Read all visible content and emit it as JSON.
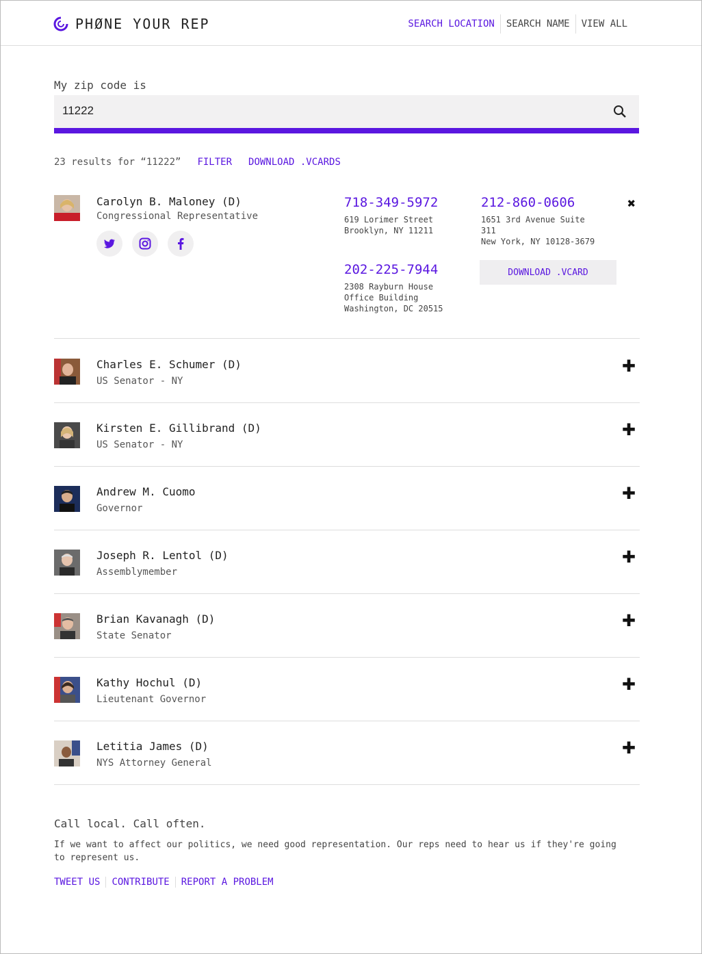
{
  "header": {
    "logo_text": "PHØNE YOUR REP",
    "nav": [
      {
        "label": "SEARCH LOCATION"
      },
      {
        "label": "SEARCH NAME"
      },
      {
        "label": "VIEW ALL"
      }
    ]
  },
  "search": {
    "label": "My zip code is",
    "value": "11222"
  },
  "results": {
    "summary": "23 results for “11222”",
    "filter_label": "FILTER",
    "download_label": "DOWNLOAD .VCARDS"
  },
  "expanded_rep": {
    "name": "Carolyn B. Maloney (D)",
    "title": "Congressional Representative",
    "offices": [
      {
        "phone": "718-349-5972",
        "address_1": "619 Lorimer Street",
        "address_2": "Brooklyn, NY 11211",
        "address_3": ""
      },
      {
        "phone": "212-860-0606",
        "address_1": "1651 3rd Avenue Suite",
        "address_2": "311",
        "address_3": "New York, NY 10128-3679"
      },
      {
        "phone": "202-225-7944",
        "address_1": "2308 Rayburn House",
        "address_2": "Office Building",
        "address_3": "Washington, DC 20515"
      }
    ],
    "vcard_label": "DOWNLOAD .VCARD",
    "social": [
      "twitter-icon",
      "instagram-icon",
      "facebook-icon"
    ]
  },
  "reps": [
    {
      "name": "Charles E. Schumer (D)",
      "title": "US Senator - NY"
    },
    {
      "name": "Kirsten E. Gillibrand (D)",
      "title": "US Senator - NY"
    },
    {
      "name": "Andrew M. Cuomo",
      "title": "Governor"
    },
    {
      "name": "Joseph R. Lentol (D)",
      "title": "Assemblymember"
    },
    {
      "name": "Brian Kavanagh (D)",
      "title": "State Senator"
    },
    {
      "name": "Kathy Hochul (D)",
      "title": "Lieutenant Governor"
    },
    {
      "name": "Letitia James (D)",
      "title": "NYS Attorney General"
    }
  ],
  "footer": {
    "tagline": "Call local. Call often.",
    "mission": "If we want to affect our politics, we need good representation. Our reps need to hear us if they're going to represent us.",
    "links": [
      {
        "label": "TWEET US"
      },
      {
        "label": "CONTRIBUTE"
      },
      {
        "label": "REPORT A PROBLEM"
      }
    ]
  },
  "colors": {
    "accent": "#5a17e0",
    "input_bg": "#f2f1f2",
    "divider": "#dddddd"
  }
}
